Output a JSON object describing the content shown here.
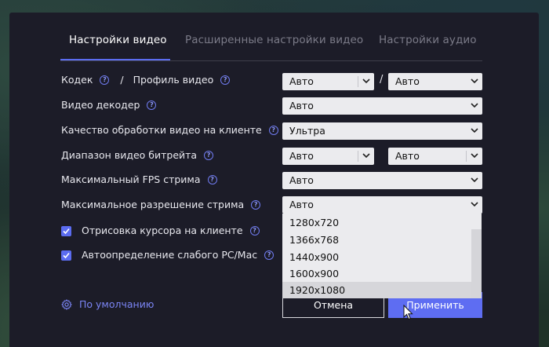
{
  "tabs": [
    {
      "label": "Настройки видео",
      "active": true
    },
    {
      "label": "Расширенные настройки видео",
      "active": false
    },
    {
      "label": "Настройки аудио",
      "active": false
    }
  ],
  "rows": {
    "codec": {
      "label": "Кодек",
      "profile_label": "Профиль видео",
      "codec_value": "Авто",
      "profile_value": "Авто"
    },
    "decoder": {
      "label": "Видео декодер",
      "value": "Авто"
    },
    "quality": {
      "label": "Качество обработки видео на клиенте",
      "value": "Ультра"
    },
    "bitrate": {
      "label": "Диапазон видео битрейта",
      "min_value": "Авто",
      "max_value": "Авто"
    },
    "fps": {
      "label": "Максимальный FPS стрима",
      "value": "Авто"
    },
    "resolution": {
      "label": "Максимальное разрешение стрима",
      "value": "Авто",
      "options": [
        "1280x720",
        "1366x768",
        "1440x900",
        "1600x900",
        "1920x1080"
      ],
      "hovered": "1920x1080"
    }
  },
  "checkboxes": [
    {
      "label": "Отрисовка курсора на клиенте",
      "checked": true
    },
    {
      "label": "Автоопределение слабого PC/Mac",
      "checked": true
    }
  ],
  "footer": {
    "defaults_label": "По умолчанию",
    "cancel_label": "Отмена",
    "apply_label": "Применить"
  },
  "help_glyph": "?",
  "colors": {
    "accent": "#5e6df2",
    "dialog_bg": "#1c1c28",
    "select_bg": "#ebebee"
  },
  "icons": [
    "help-icon",
    "chevron-down-icon",
    "gear-icon",
    "checkmark-icon",
    "mouse-pointer-icon"
  ]
}
